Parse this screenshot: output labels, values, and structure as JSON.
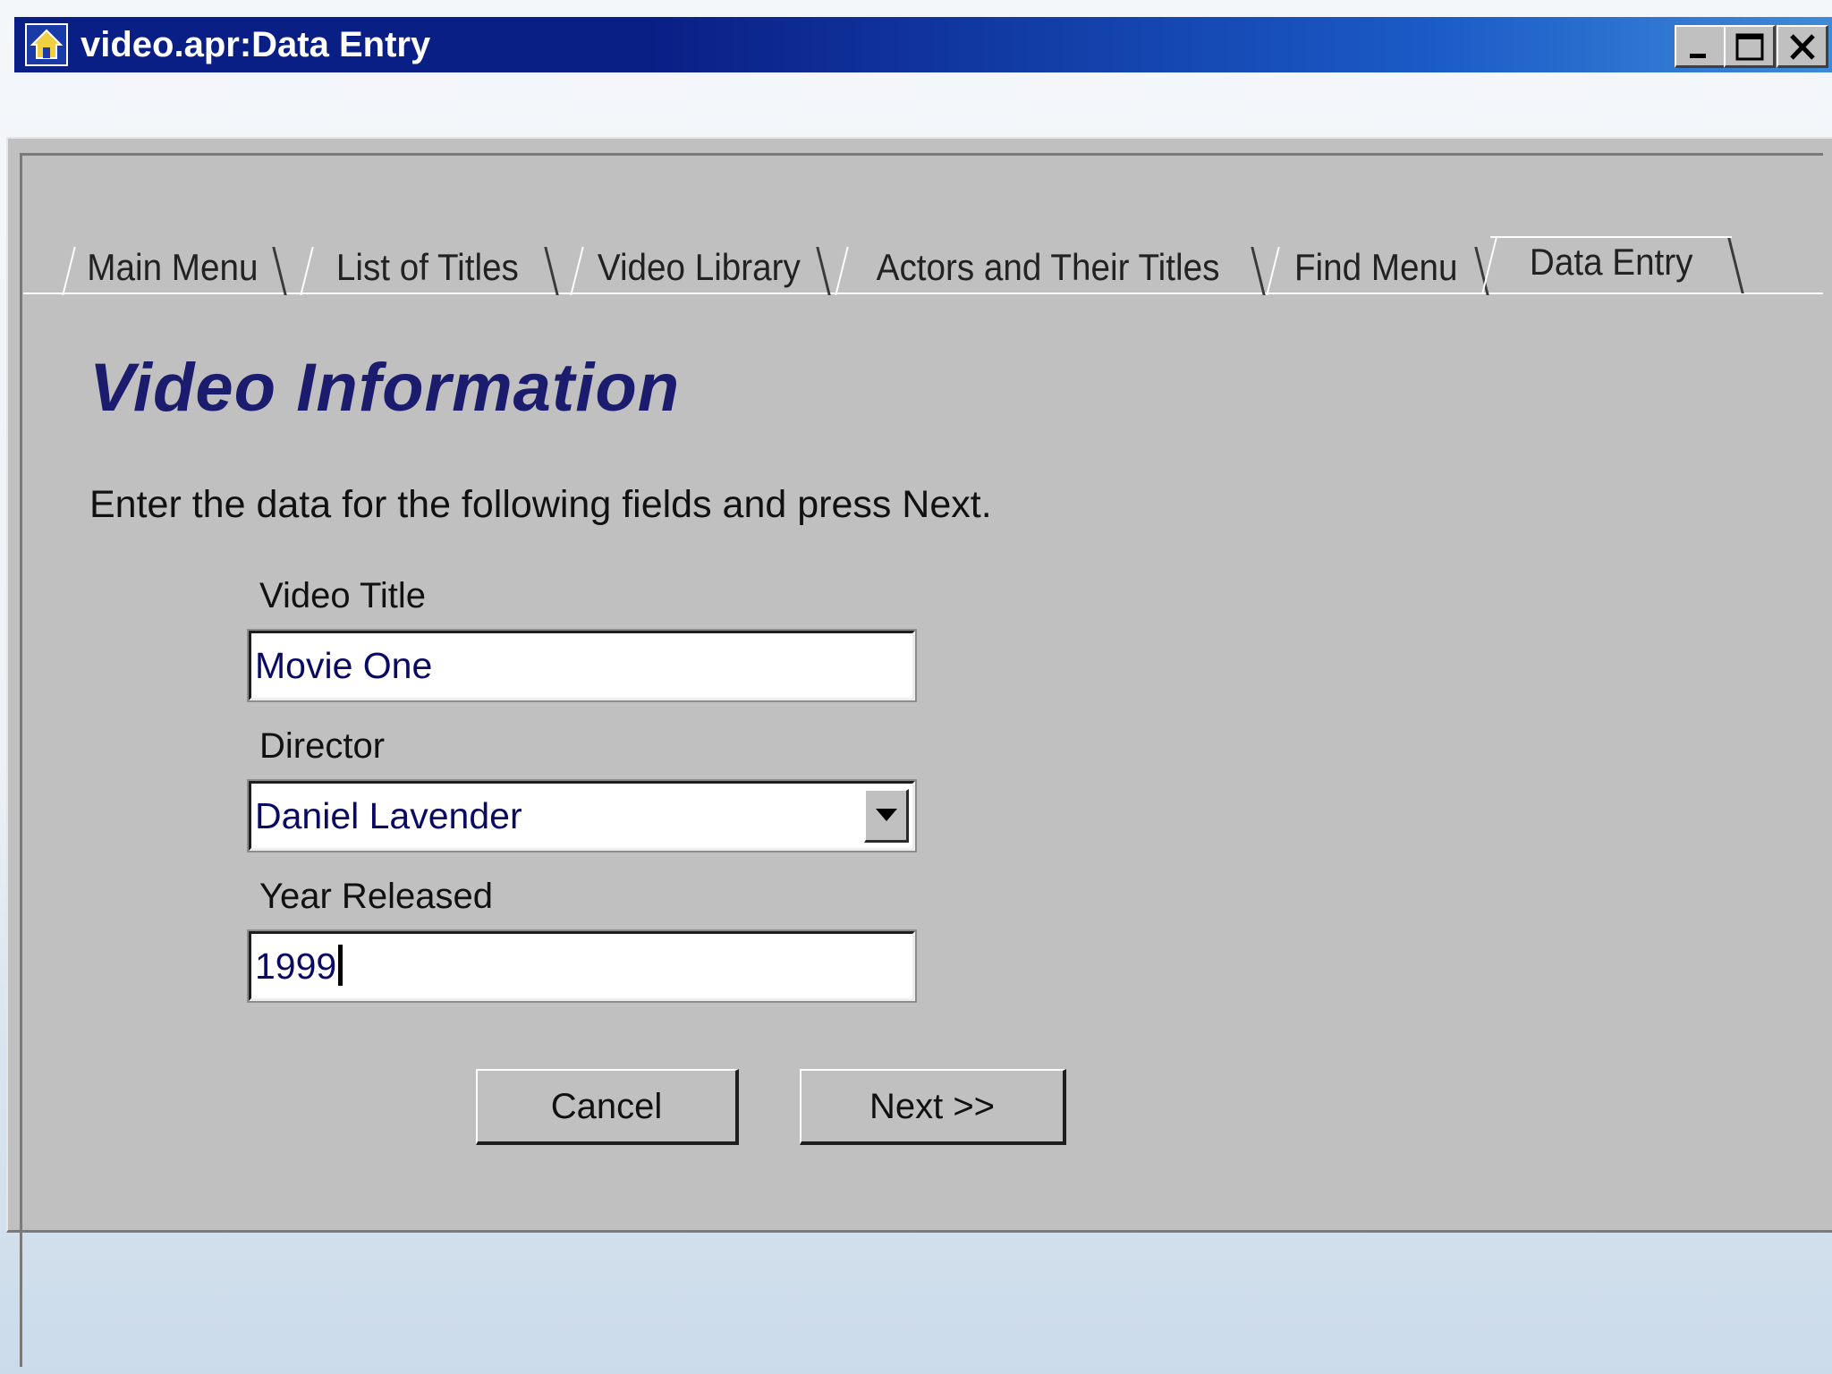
{
  "window": {
    "title": "video.apr:Data Entry",
    "controls": {
      "minimize": "minimize-icon",
      "maximize": "maximize-icon",
      "close": "close-icon"
    }
  },
  "tabs": [
    {
      "label": "Main Menu",
      "active": false
    },
    {
      "label": "List of Titles",
      "active": false
    },
    {
      "label": "Video Library",
      "active": false
    },
    {
      "label": "Actors and Their Titles",
      "active": false
    },
    {
      "label": "Find Menu",
      "active": false
    },
    {
      "label": "Data Entry",
      "active": true
    }
  ],
  "form": {
    "heading": "Video Information",
    "instructions": "Enter the data for the following fields and press Next.",
    "video_title": {
      "label": "Video Title",
      "value": "Movie One"
    },
    "director": {
      "label": "Director",
      "value": "Daniel Lavender"
    },
    "year_released": {
      "label": "Year Released",
      "value": "1999"
    }
  },
  "buttons": {
    "cancel": "Cancel",
    "next": "Next >>"
  },
  "colors": {
    "titlebar_start": "#0a1f86",
    "titlebar_end": "#3f8ad9",
    "heading": "#1c1c6e",
    "field_text": "#0a0a64",
    "panel": "#c0c0c0"
  }
}
